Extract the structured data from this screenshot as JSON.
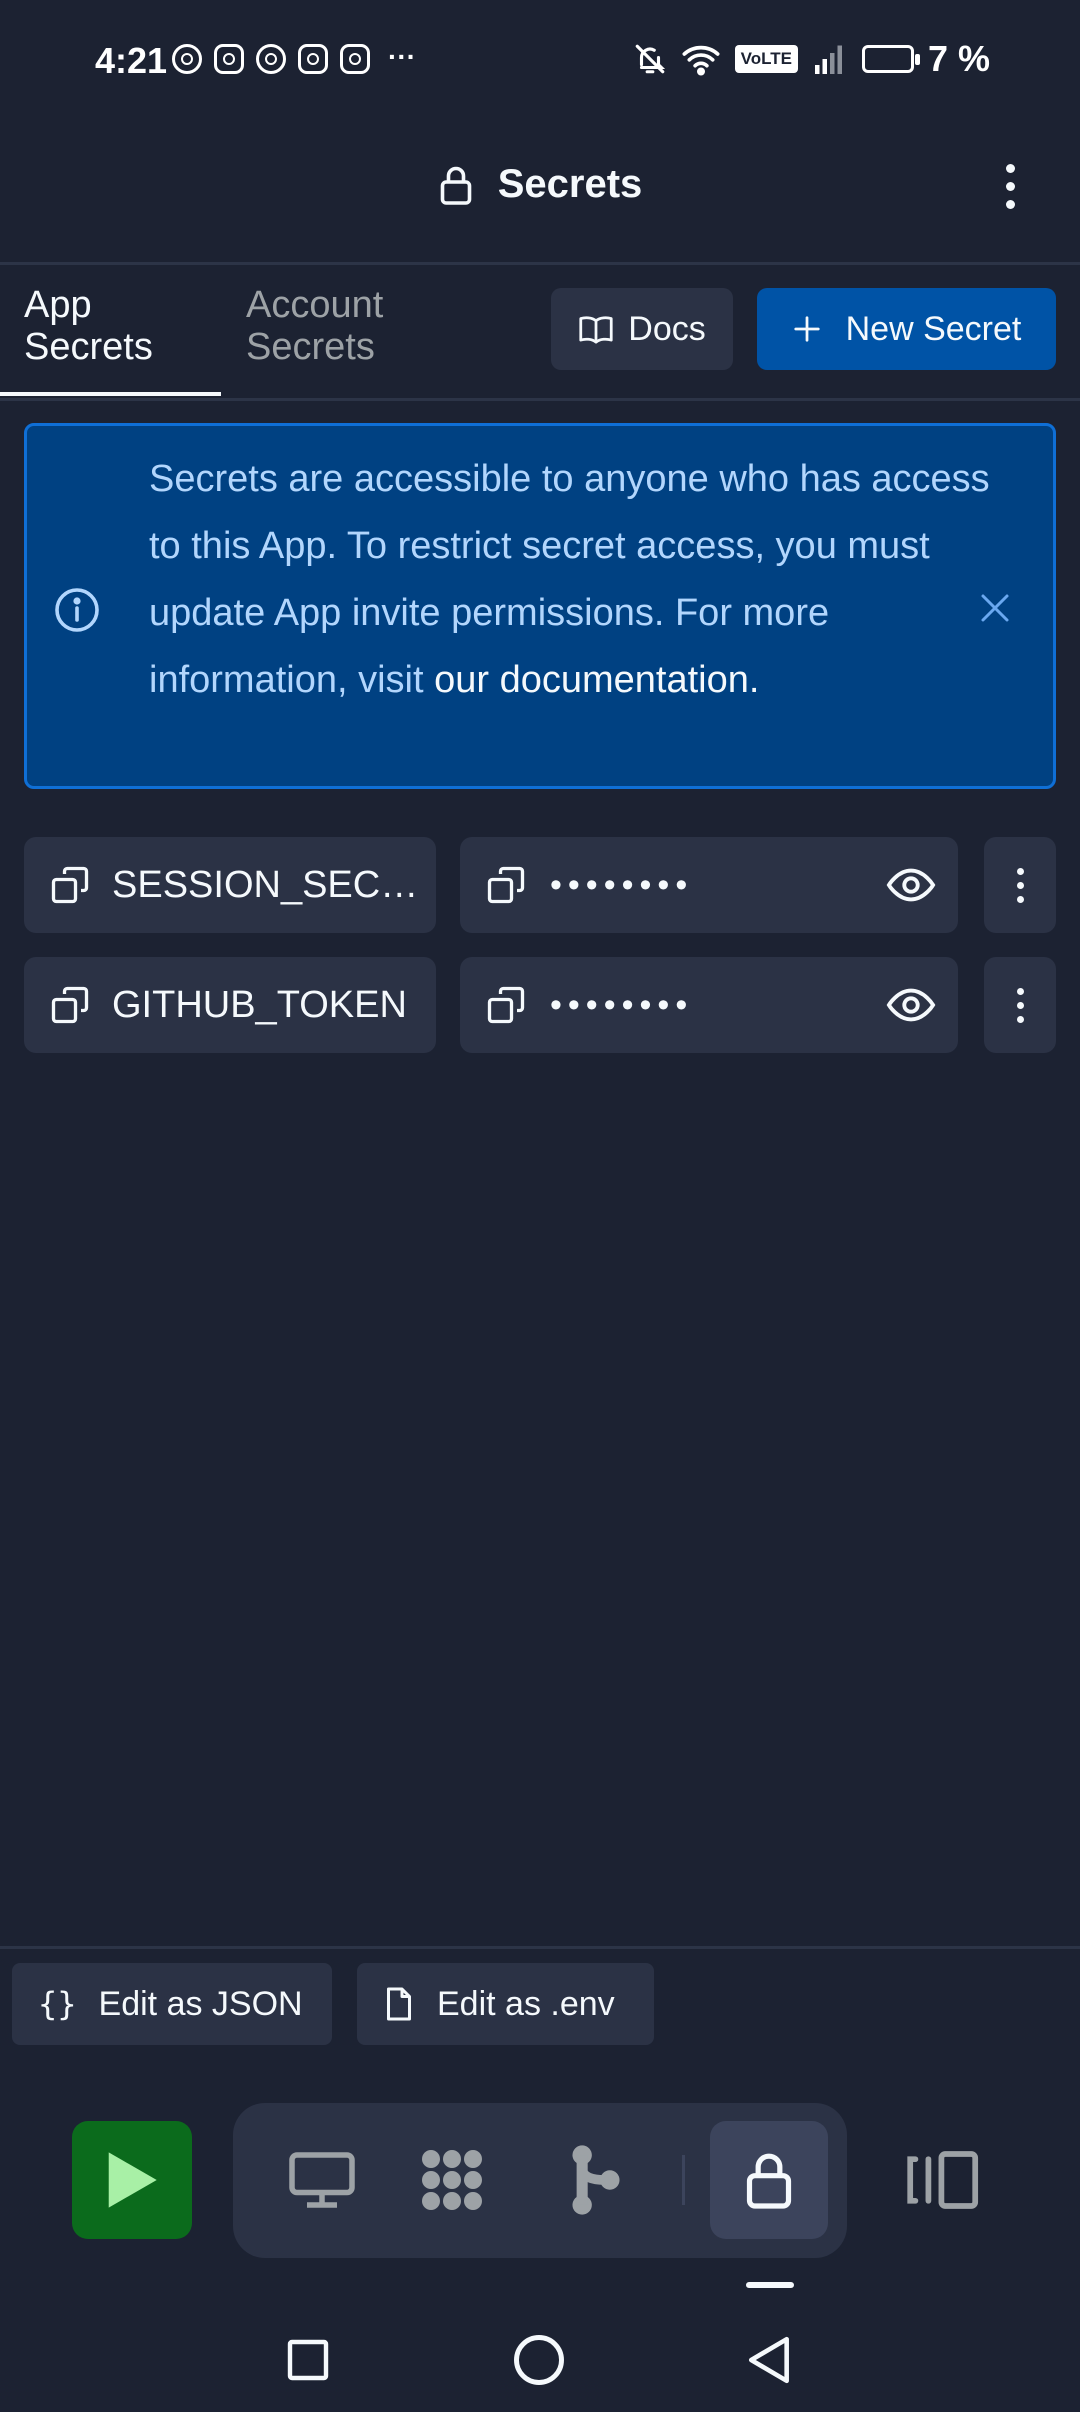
{
  "status_bar": {
    "time": "4:21",
    "app_icons": [
      "whatsapp-icon",
      "instagram-icon",
      "a-icon",
      "instagram-icon",
      "instagram-icon"
    ],
    "more": "···",
    "volte": "VoLTE",
    "battery": "7 %"
  },
  "header": {
    "title": "Secrets"
  },
  "tabs": [
    {
      "label": "App Secrets",
      "line1": "App",
      "line2": "Secrets",
      "active": true
    },
    {
      "label": "Account Secrets",
      "line1": "Account",
      "line2": "Secrets",
      "active": false
    }
  ],
  "toolbar": {
    "docs_label": "Docs",
    "new_secret_label": "New Secret"
  },
  "banner": {
    "text": "Secrets are accessible to anyone who has access to this App. To restrict secret access, you must update App invite permissions. For more information, visit ",
    "link_text": "our documentation."
  },
  "secrets": [
    {
      "key": "SESSION_SECRET",
      "value": "••••••••"
    },
    {
      "key": "GITHUB_TOKEN",
      "value": "••••••••"
    }
  ],
  "edit_actions": {
    "json_label": "Edit as JSON",
    "env_label": "Edit as .env"
  },
  "colors": {
    "background": "#1c2232",
    "surface": "#2b3245",
    "primary": "#0053a6",
    "banner_bg": "#004182",
    "banner_text": "#b2d6fd",
    "run_green": "#0b6b1c"
  }
}
